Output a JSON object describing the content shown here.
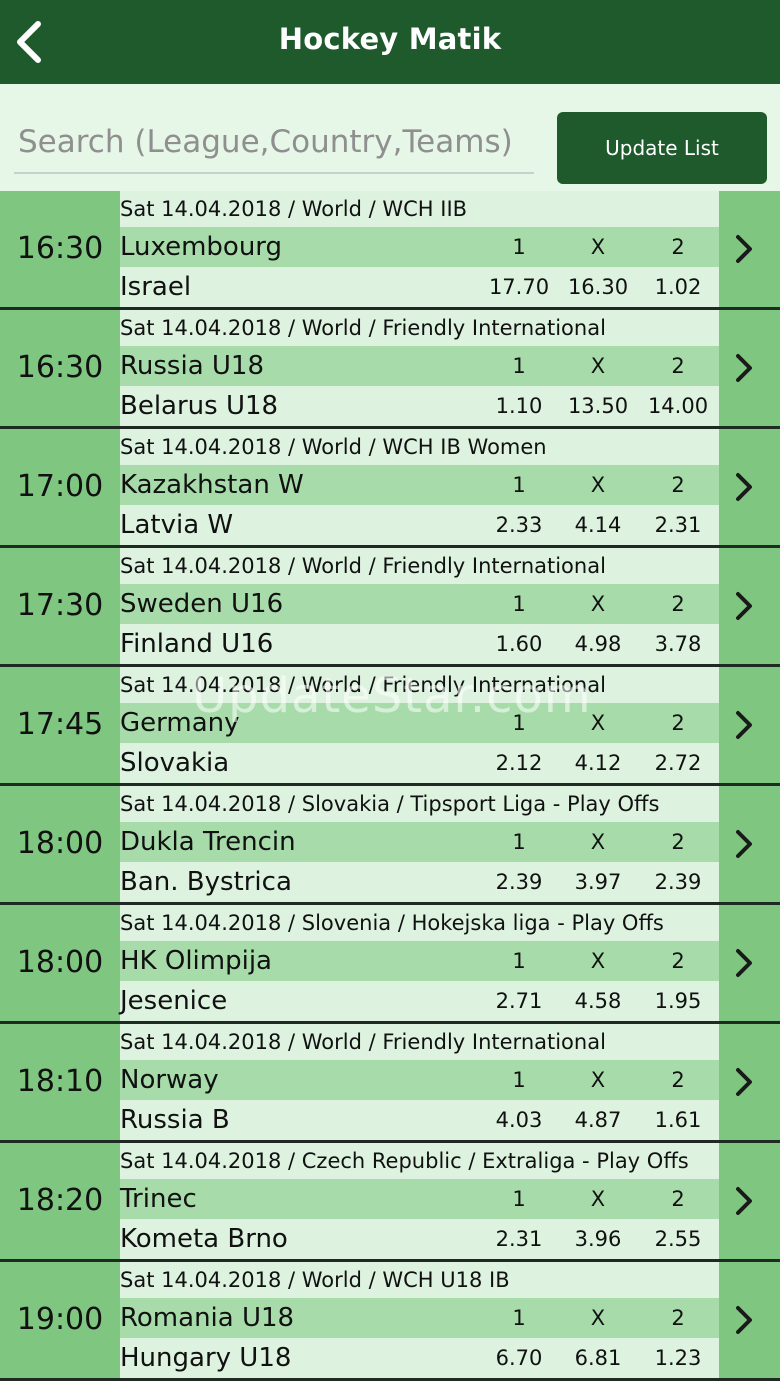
{
  "nav": {
    "back_icon": "chevron-left-icon",
    "title": "Hockey Matik"
  },
  "search": {
    "placeholder": "Search (League,Country,Teams)",
    "value": "",
    "update_label": "Update List"
  },
  "watermark": "UpdateStar.com",
  "matches": [
    {
      "time": "16:30",
      "header": "Sat 14.04.2018 / World / WCH IIB",
      "home": "Luxembourg",
      "away": "Israel",
      "label1": "1",
      "labelx": "X",
      "label2": "2",
      "odd1": "17.70",
      "oddx": "16.30",
      "odd2": "1.02"
    },
    {
      "time": "16:30",
      "header": "Sat 14.04.2018 / World / Friendly International",
      "home": "Russia U18",
      "away": "Belarus U18",
      "label1": "1",
      "labelx": "X",
      "label2": "2",
      "odd1": "1.10",
      "oddx": "13.50",
      "odd2": "14.00"
    },
    {
      "time": "17:00",
      "header": "Sat 14.04.2018 / World / WCH IB Women",
      "home": "Kazakhstan W",
      "away": "Latvia W",
      "label1": "1",
      "labelx": "X",
      "label2": "2",
      "odd1": "2.33",
      "oddx": "4.14",
      "odd2": "2.31"
    },
    {
      "time": "17:30",
      "header": "Sat 14.04.2018 / World / Friendly International",
      "home": "Sweden U16",
      "away": "Finland U16",
      "label1": "1",
      "labelx": "X",
      "label2": "2",
      "odd1": "1.60",
      "oddx": "4.98",
      "odd2": "3.78"
    },
    {
      "time": "17:45",
      "header": "Sat 14.04.2018 / World / Friendly International",
      "home": "Germany",
      "away": "Slovakia",
      "label1": "1",
      "labelx": "X",
      "label2": "2",
      "odd1": "2.12",
      "oddx": "4.12",
      "odd2": "2.72"
    },
    {
      "time": "18:00",
      "header": "Sat 14.04.2018 / Slovakia / Tipsport Liga - Play Offs",
      "home": "Dukla Trencin",
      "away": "Ban. Bystrica",
      "label1": "1",
      "labelx": "X",
      "label2": "2",
      "odd1": "2.39",
      "oddx": "3.97",
      "odd2": "2.39"
    },
    {
      "time": "18:00",
      "header": "Sat 14.04.2018 / Slovenia / Hokejska liga - Play Offs",
      "home": "HK Olimpija",
      "away": "Jesenice",
      "label1": "1",
      "labelx": "X",
      "label2": "2",
      "odd1": "2.71",
      "oddx": "4.58",
      "odd2": "1.95"
    },
    {
      "time": "18:10",
      "header": "Sat 14.04.2018 / World / Friendly International",
      "home": "Norway",
      "away": "Russia B",
      "label1": "1",
      "labelx": "X",
      "label2": "2",
      "odd1": "4.03",
      "oddx": "4.87",
      "odd2": "1.61"
    },
    {
      "time": "18:20",
      "header": "Sat 14.04.2018 / Czech Republic / Extraliga - Play Offs",
      "home": "Trinec",
      "away": "Kometa Brno",
      "label1": "1",
      "labelx": "X",
      "label2": "2",
      "odd1": "2.31",
      "oddx": "3.96",
      "odd2": "2.55"
    },
    {
      "time": "19:00",
      "header": "Sat 14.04.2018 / World / WCH U18 IB",
      "home": "Romania U18",
      "away": "Hungary U18",
      "label1": "1",
      "labelx": "X",
      "label2": "2",
      "odd1": "6.70",
      "oddx": "6.81",
      "odd2": "1.23"
    }
  ]
}
